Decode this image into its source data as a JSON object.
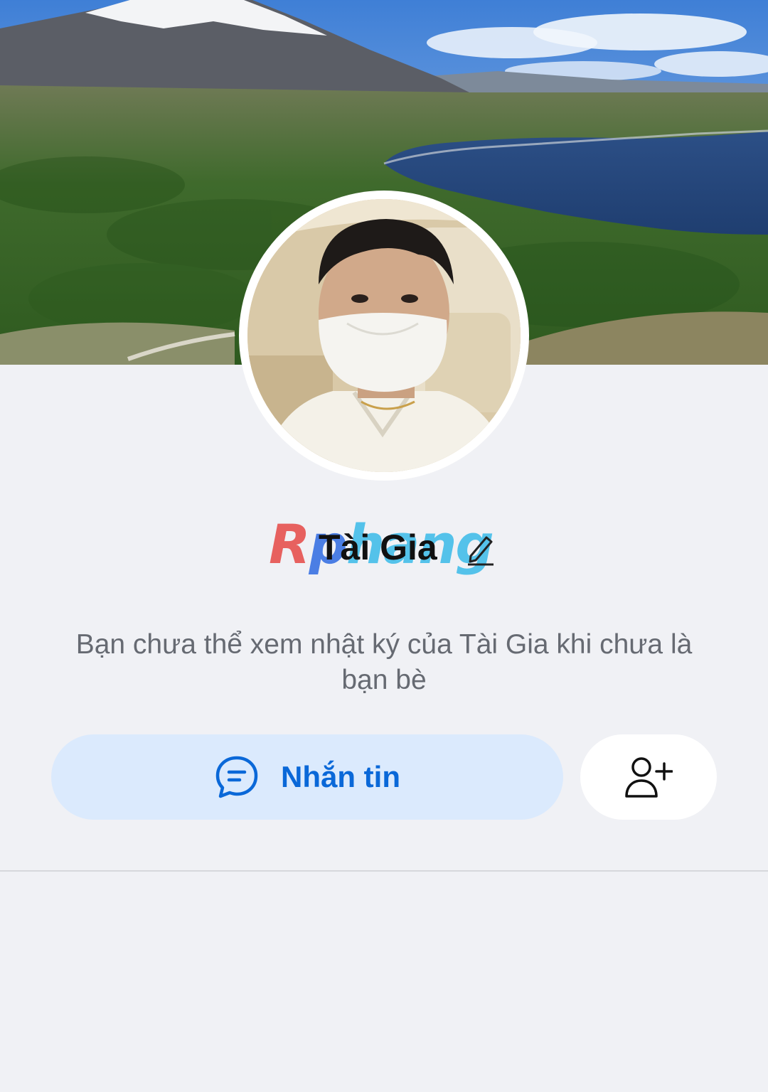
{
  "profile": {
    "name": "Tài Gia",
    "watermark": {
      "first": "R",
      "second": "p",
      "rest": "hang"
    }
  },
  "notice": {
    "text": "Bạn chưa thể xem nhật ký của Tài Gia khi chưa là bạn bè"
  },
  "actions": {
    "message_label": "Nhắn tin"
  },
  "icons": {
    "edit": "pencil-icon",
    "message": "chat-bubble-icon",
    "add_friend": "add-user-icon"
  },
  "colors": {
    "background": "#f0f1f5",
    "primary_button_bg": "#dbeafd",
    "primary_text": "#0a68d8",
    "secondary_text": "#666a72"
  }
}
